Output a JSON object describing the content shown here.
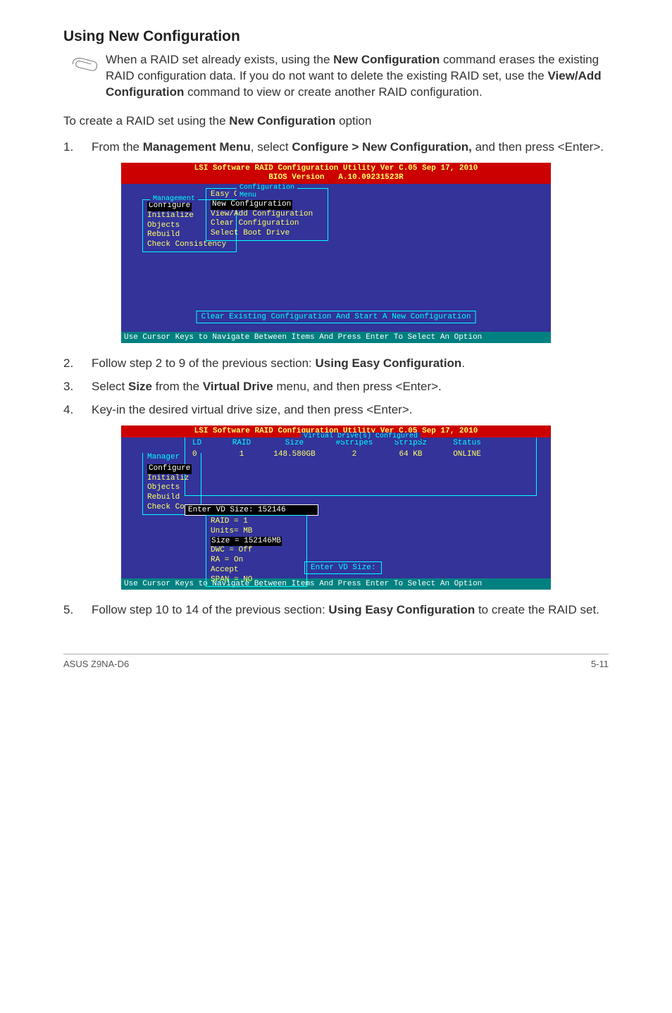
{
  "title": "Using New Configuration",
  "note": {
    "p1a": "When a RAID set already exists, using the ",
    "p1b": "New Configuration",
    "p1c": " command erases the existing RAID configuration data. If you do not want to delete the existing RAID set, use the ",
    "p1d": "View/Add Configuration",
    "p1e": " command to view or create another RAID configuration."
  },
  "intro": {
    "a": "To create a RAID set using the ",
    "b": "New Configuration",
    "c": " option"
  },
  "steps": {
    "s1": {
      "num": "1.",
      "a": "From the ",
      "b": "Management Menu",
      "c": ", select ",
      "d": "Configure > New Configuration,",
      "e": " and then press <Enter>."
    },
    "s2": {
      "num": "2.",
      "a": "Follow step 2 to 9 of the previous section: ",
      "b": "Using Easy Configuration",
      "c": "."
    },
    "s3": {
      "num": "3.",
      "a": "Select ",
      "b": "Size",
      "c": " from the ",
      "d": "Virtual Drive",
      "e": " menu, and then press <Enter>."
    },
    "s4": {
      "num": "4.",
      "a": "Key-in the desired virtual drive size, and then press <Enter>."
    },
    "s5": {
      "num": "5.",
      "a": "Follow step 10 to 14 of the previous section: ",
      "b": "Using Easy Configuration",
      "c": " to create the RAID set."
    }
  },
  "bios1": {
    "header": "LSI Software RAID Configuration Utility Ver C.05 Sep 17, 2010\nBIOS Version   A.10.09231523R",
    "mgmt_title": "Management",
    "mgmt": [
      "Configure",
      "Initialize",
      "Objects",
      "Rebuild",
      "Check Consistency"
    ],
    "cfg_title": "Configuration Menu",
    "cfg": [
      "Easy Configuration",
      "New Configuration",
      "View/Add Configuration",
      "Clear Configuration",
      "Select Boot Drive"
    ],
    "msg": "Clear Existing Configuration And Start A New Configuration",
    "footer": "Use Cursor Keys to Navigate Between Items And Press Enter To Select An Option"
  },
  "bios2": {
    "header": "LSI Software RAID Configuration Utility Ver C.05 Sep 17, 2010",
    "vd_title": "Virtual Drive(s) Configured",
    "cols": {
      "ld": "LD",
      "raid": "RAID",
      "size": "Size",
      "stripes": "#Stripes",
      "stripsz": "StripSz",
      "status": "Status"
    },
    "row": {
      "ld": "0",
      "raid": "1",
      "size": "148.580GB",
      "stripes": "2",
      "stripsz": "64 KB",
      "status": "ONLINE"
    },
    "mgmt": [
      "Manager",
      "Configure",
      "Initializ",
      "Objects",
      "Rebuild",
      "Check Co"
    ],
    "input_label": "Enter VD Size: ",
    "input_value": "152146",
    "props": {
      "l1": "RAID = 1",
      "l2": "Units= MB",
      "l3a": "Size = ",
      "l3b": "152146MB",
      "l4": "DWC  = Off",
      "l5": "RA   = On",
      "l6": "Accept",
      "l7": "SPAN = NO"
    },
    "prompt": "Enter VD Size:",
    "footer": "Use Cursor Keys to Navigate Between Items And Press Enter To Select An Option"
  },
  "footer": {
    "left": "ASUS Z9NA-D6",
    "right": "5-11"
  }
}
